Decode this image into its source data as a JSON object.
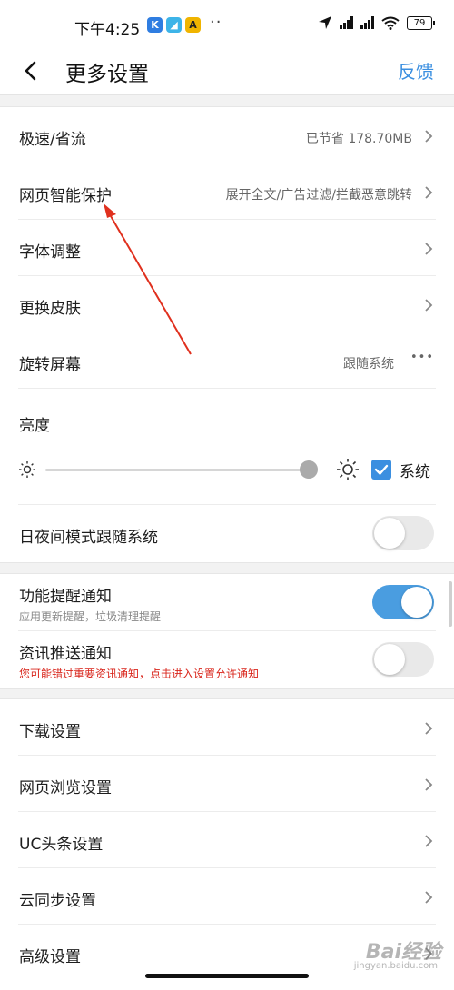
{
  "status_bar": {
    "time": "下午4:25",
    "app_icons": [
      {
        "icon": "k-app-icon",
        "glyph": "K",
        "color": "#2f7de1"
      },
      {
        "icon": "paper-plane-icon",
        "glyph": "◢",
        "color": "#3db4e8"
      },
      {
        "icon": "a-app-icon",
        "glyph": "A",
        "color": "#f0b400"
      }
    ],
    "dots": "··",
    "battery": "79"
  },
  "nav": {
    "title": "更多设置",
    "feedback": "反馈"
  },
  "group1": {
    "speed": {
      "label": "极速/省流",
      "value": "已节省 178.70MB"
    },
    "protect": {
      "label": "网页智能保护",
      "value": "展开全文/广告过滤/拦截恶意跳转"
    },
    "font": {
      "label": "字体调整"
    },
    "skin": {
      "label": "更换皮肤"
    },
    "rotate": {
      "label": "旋转屏幕",
      "value": "跟随系统",
      "more": "•••"
    },
    "brightness": {
      "label": "亮度",
      "level": 0.96,
      "system_checked": true,
      "system_label": "系统"
    },
    "daynight": {
      "label": "日夜间模式跟随系统",
      "on": false
    }
  },
  "group2": {
    "feature_notify": {
      "label": "功能提醒通知",
      "sub": "应用更新提醒，垃圾清理提醒",
      "on": true
    },
    "news_notify": {
      "label": "资讯推送通知",
      "sub": "您可能错过重要资讯通知，点击进入设置允许通知",
      "on": false
    }
  },
  "group3": {
    "download": {
      "label": "下载设置"
    },
    "browse": {
      "label": "网页浏览设置"
    },
    "uc": {
      "label": "UC头条设置"
    },
    "cloud": {
      "label": "云同步设置"
    },
    "advanced": {
      "label": "高级设置"
    }
  },
  "watermark": {
    "text": "Bai经验",
    "sub": "jingyan.baidu.com"
  },
  "colors": {
    "accent": "#3b8fe0",
    "toggle_on": "#4a9de0",
    "warning": "#d9261c",
    "annotation_arrow": "#e0301e"
  }
}
